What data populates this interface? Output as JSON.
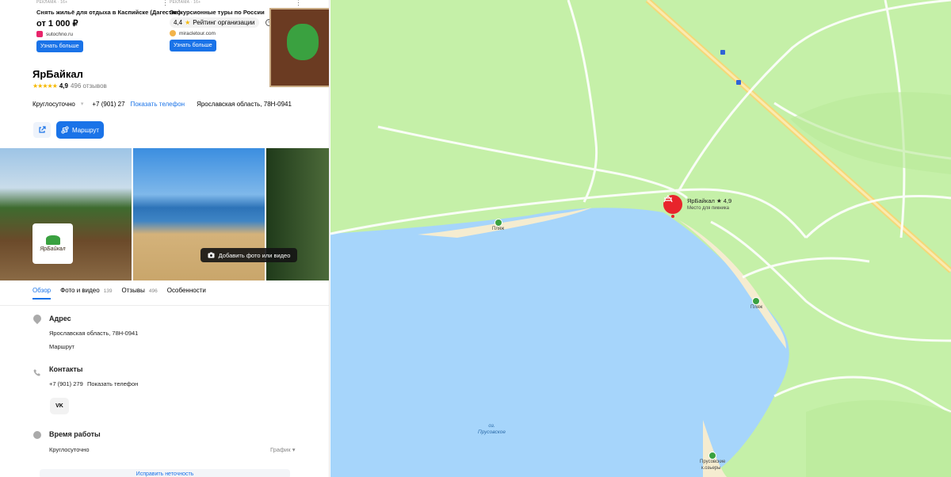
{
  "ads": [
    {
      "tag": "РЕКЛАМА · 16+",
      "title": "Снять жильё для отдыха в Каспийске (Дагестан)",
      "price": "от 1 000 ₽",
      "domain": "sutochno.ru",
      "button": "Узнать больше"
    },
    {
      "tag": "РЕКЛАМА · 16+",
      "title": "Экскурсионные туры по России",
      "rating": "4,4",
      "rating_label": "Рейтинг организации",
      "domain": "miracletour.com",
      "button": "Узнать больше"
    }
  ],
  "org": {
    "title": "ЯрБайкал",
    "score": "4,9",
    "reviews": "496 отзывов",
    "hours": "Круглосуточно",
    "phone": "+7 (901) 27",
    "show_phone": "Показать телефон",
    "address": "Ярославская область, 78Н-0941",
    "route_label": "Маршрут",
    "logo_text": "ЯрБайкал",
    "add_photo": "Добавить фото или видео"
  },
  "tabs": [
    {
      "label": "Обзор",
      "count": ""
    },
    {
      "label": "Фото и видео",
      "count": "139"
    },
    {
      "label": "Отзывы",
      "count": "496"
    },
    {
      "label": "Особенности",
      "count": ""
    }
  ],
  "sections": {
    "address_title": "Адрес",
    "address_text": "Ярославская область, 78Н-0941",
    "address_link": "Маршрут",
    "contacts_title": "Контакты",
    "contacts_phone": "+7 (901) 279",
    "contacts_show": "Показать телефон",
    "vk": "VK",
    "hours_title": "Время работы",
    "hours_text": "Круглосуточно",
    "schedule": "График",
    "bottom": "Исправить неточность"
  },
  "map": {
    "place_title": "ЯрБайкал ★ 4,9",
    "place_sub": "Место для пикника",
    "beach": "Пляж",
    "lake_name_1": "оз.",
    "lake_name_2": "Прусовское",
    "poi3_line1": "Прусовские",
    "poi3_line2": "к.озьеры"
  },
  "colors": {
    "accent": "#1a73e8",
    "pin": "#e8242b",
    "water": "#a6d5fb",
    "forest": "#c5f0a8"
  }
}
